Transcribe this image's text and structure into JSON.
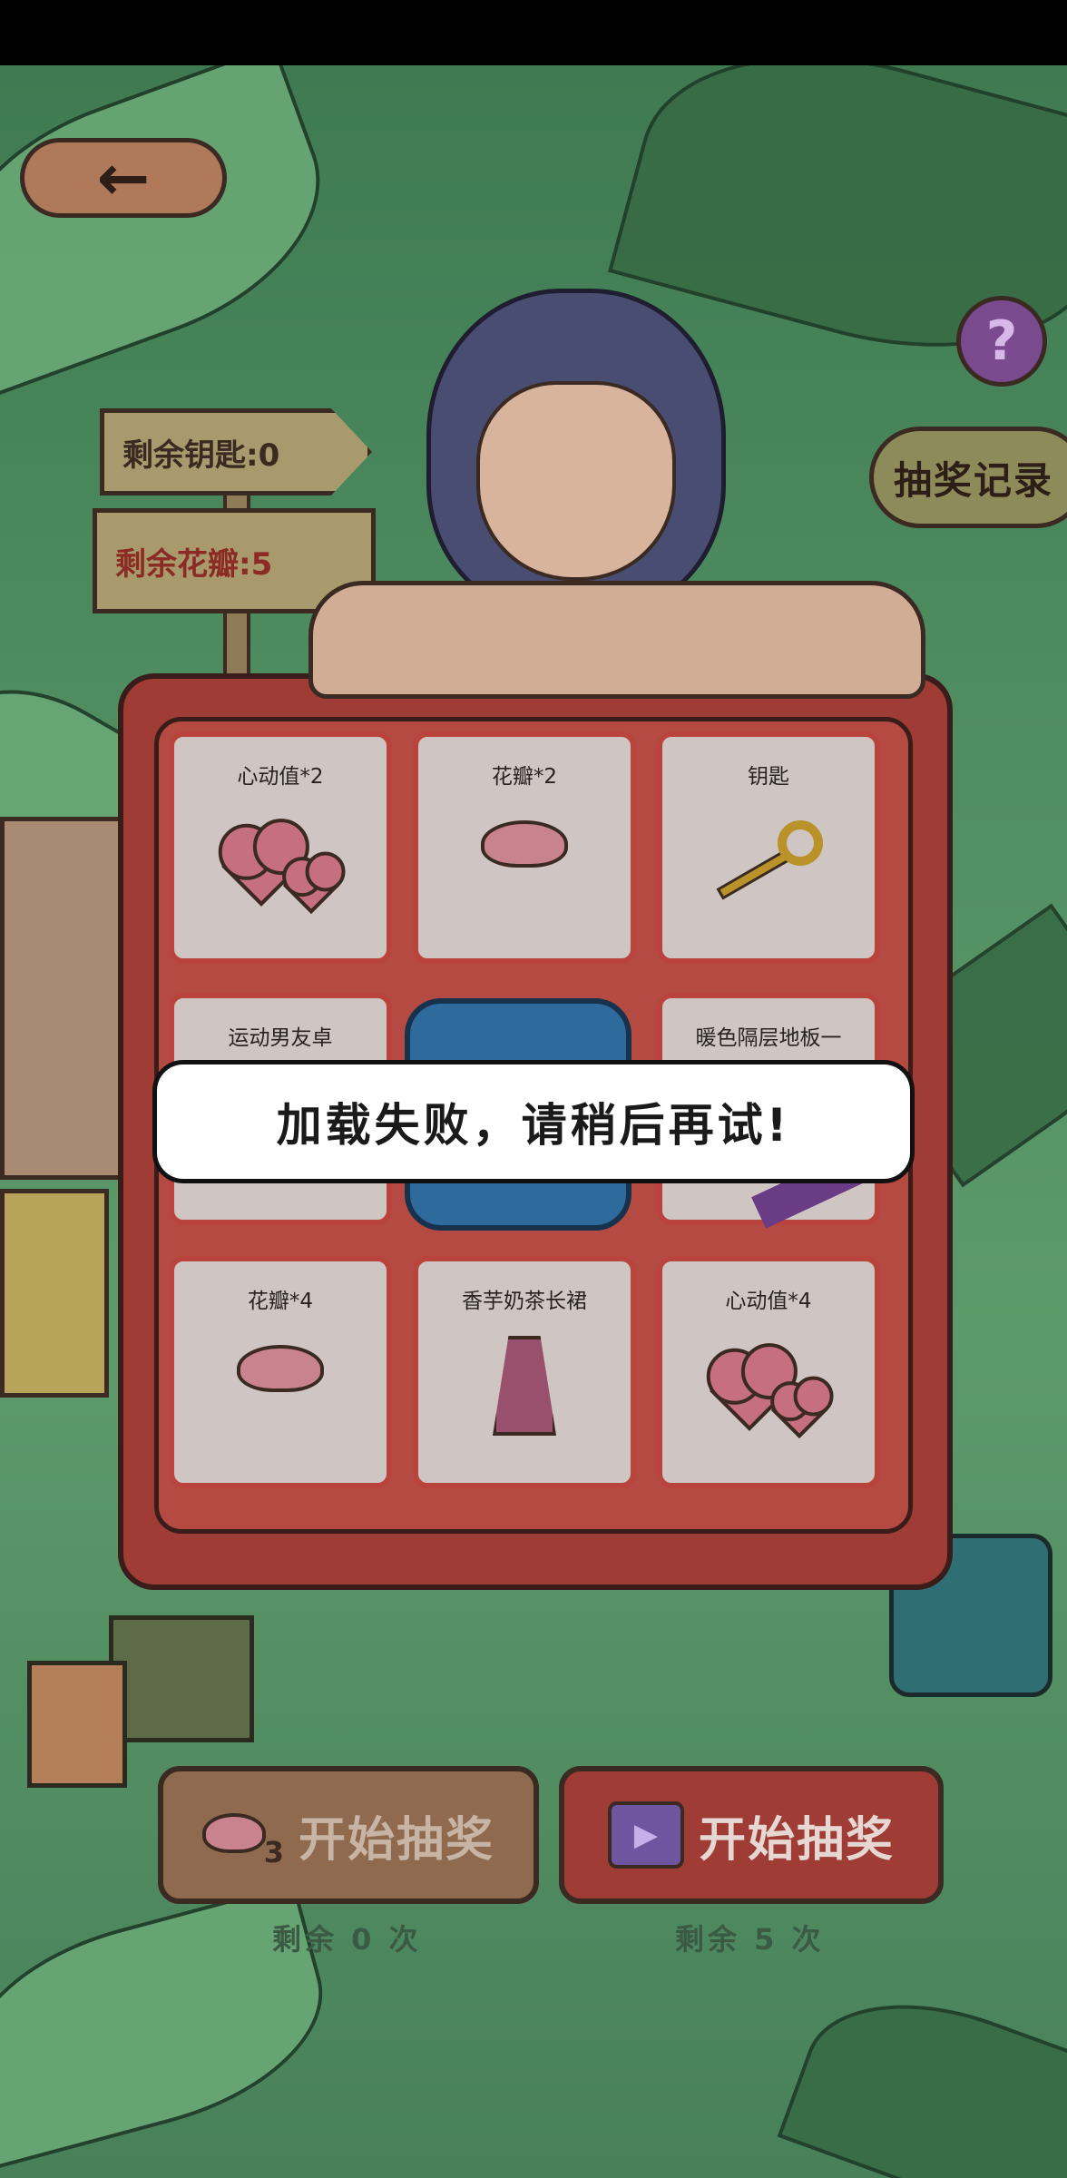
{
  "header": {
    "back_icon": "←",
    "help_icon": "?",
    "record_label": "抽奖记录"
  },
  "signs": {
    "keys_label": "剩余钥匙:0",
    "petals_label": "剩余花瓣:5"
  },
  "prize_grid": {
    "cells": [
      {
        "label": "心动值*2",
        "icon": "hearts-icon"
      },
      {
        "label": "花瓣*2",
        "icon": "petal-icon"
      },
      {
        "label": "钥匙",
        "icon": "key-icon"
      },
      {
        "label": "运动男友卓",
        "icon": "outfit-icon"
      },
      {
        "label": "",
        "icon": "video-icon"
      },
      {
        "label": "暖色隔层地板一",
        "icon": "floor-icon"
      },
      {
        "label": "花瓣*4",
        "icon": "petal-icon"
      },
      {
        "label": "香芋奶茶长裙",
        "icon": "skirt-icon"
      },
      {
        "label": "心动值*4",
        "icon": "hearts-icon"
      }
    ]
  },
  "toast": {
    "message": "加载失败，请稍后再试!"
  },
  "actions": {
    "petal_draw_label": "开始抽奖",
    "petal_cost": "3",
    "video_draw_label": "开始抽奖",
    "video_icon": "▶",
    "petal_remaining": "剩余 0 次",
    "video_remaining": "剩余 5 次"
  },
  "colors": {
    "machine_red": "#9e3c35",
    "cell_border": "#b9443d",
    "toast_bg": "#ffffff",
    "scene_green": "#4f8c60"
  }
}
